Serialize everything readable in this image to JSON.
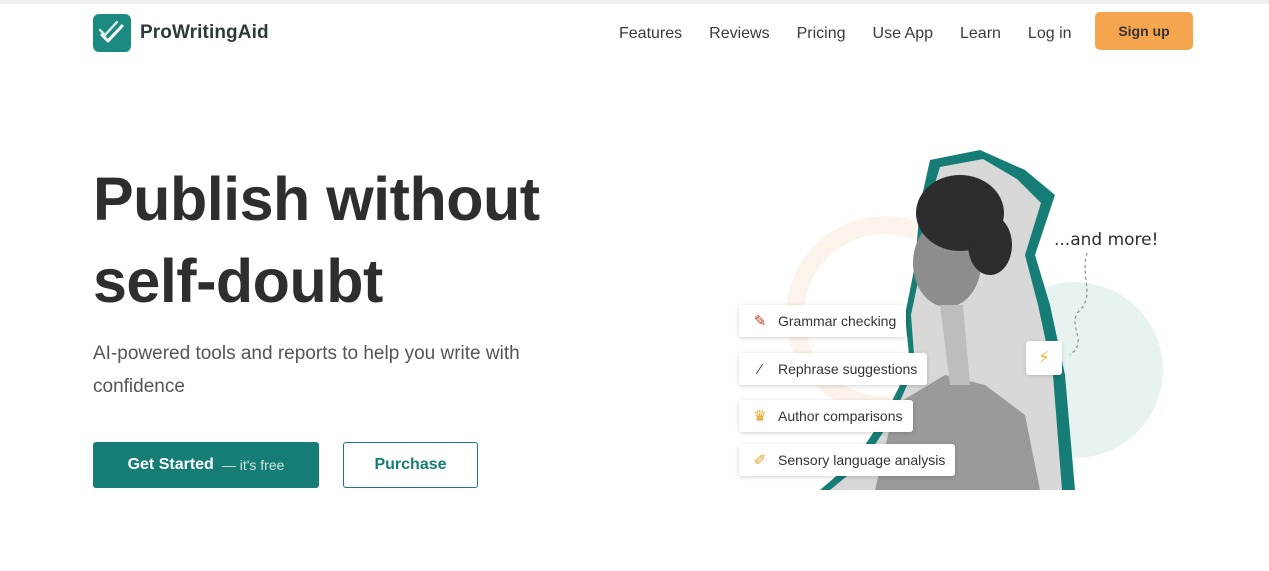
{
  "brand": {
    "name": "ProWritingAid"
  },
  "nav": {
    "items": [
      "Features",
      "Reviews",
      "Pricing",
      "Use App",
      "Learn",
      "Log in"
    ],
    "signup_label": "Sign up"
  },
  "hero": {
    "title_line1": "Publish without",
    "title_line2": "self-doubt",
    "subtitle": "AI-powered tools and reports to help you write with confidence",
    "cta_primary": "Get Started",
    "cta_primary_note": "— it's free",
    "cta_secondary": "Purchase"
  },
  "features": {
    "items": [
      {
        "label": "Grammar checking",
        "icon": "feather-icon"
      },
      {
        "label": "Rephrase suggestions",
        "icon": "magic-wand-icon"
      },
      {
        "label": "Author comparisons",
        "icon": "crown-icon"
      },
      {
        "label": "Sensory language analysis",
        "icon": "pencil-icon"
      }
    ],
    "more_label": "...and more!",
    "extra_icon": "lightning-icon"
  },
  "colors": {
    "brand_teal": "#157d76",
    "signup_orange": "#f6a54f",
    "accent_teal": "#1d8a82"
  }
}
